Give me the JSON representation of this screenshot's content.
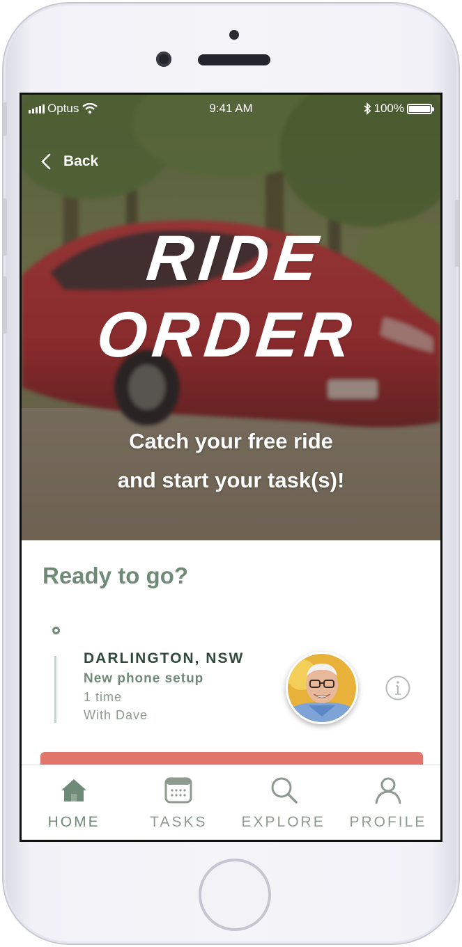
{
  "status_bar": {
    "carrier": "Optus",
    "time": "9:41 AM",
    "battery": "100%"
  },
  "nav": {
    "back_label": "Back"
  },
  "hero": {
    "title_line1": "RIDE",
    "title_line2": "ORDER",
    "subtitle_line1": "Catch your free ride",
    "subtitle_line2": "and start your task(s)!"
  },
  "main": {
    "heading": "Ready to go?",
    "task": {
      "location": "DARLINGTON, NSW",
      "name": "New phone setup",
      "frequency": "1 time",
      "with": "With Dave"
    }
  },
  "tabbar": {
    "items": [
      {
        "label": "HOME",
        "icon": "home-icon",
        "active": true
      },
      {
        "label": "TASKS",
        "icon": "calendar-icon",
        "active": false
      },
      {
        "label": "EXPLORE",
        "icon": "search-icon",
        "active": false
      },
      {
        "label": "PROFILE",
        "icon": "person-icon",
        "active": false
      }
    ]
  },
  "colors": {
    "accent_green": "#6f8a76",
    "dark_green": "#2f4a3c",
    "cta_red": "#e0756c",
    "tab_inactive": "#8c9a90"
  }
}
